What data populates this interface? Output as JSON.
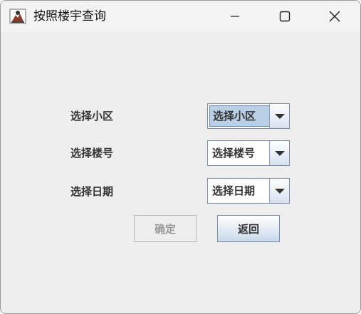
{
  "window": {
    "title": "按照楼宇查询"
  },
  "form": {
    "rows": [
      {
        "label": "选择小区",
        "value": "选择小区"
      },
      {
        "label": "选择楼号",
        "value": "选择楼号"
      },
      {
        "label": "选择日期",
        "value": "选择日期"
      }
    ]
  },
  "buttons": {
    "ok_label": "确定",
    "back_label": "返回"
  },
  "colors": {
    "window_bg": "#eeeeee",
    "selection": "#b8cfe5",
    "disabled_text": "#9a9a9a"
  }
}
